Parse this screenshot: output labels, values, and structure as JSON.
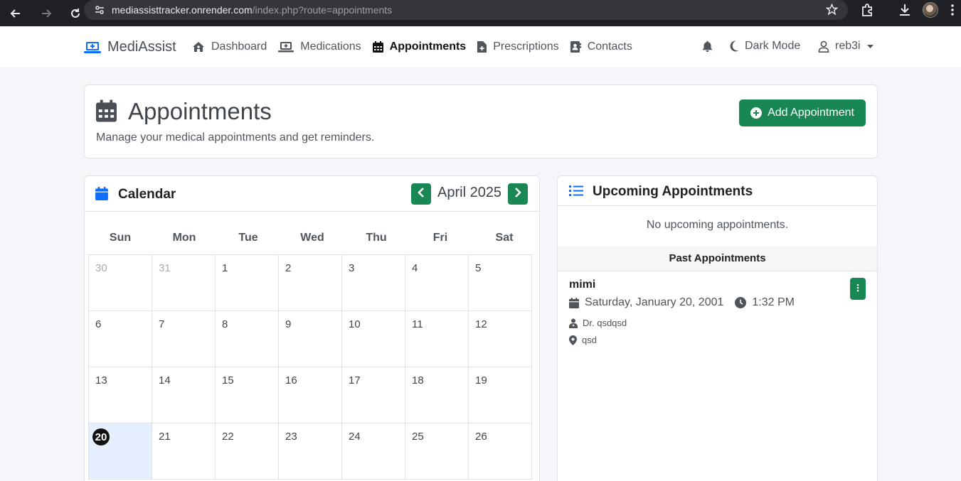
{
  "browser": {
    "url_domain": "mediassisttracker.onrender.com",
    "url_path": "/index.php?route=appointments"
  },
  "navbar": {
    "brand": "MediAssist",
    "links": [
      {
        "label": "Dashboard",
        "icon": "house-icon"
      },
      {
        "label": "Medications",
        "icon": "medical-kit-icon"
      },
      {
        "label": "Appointments",
        "icon": "calendar-icon",
        "active": true
      },
      {
        "label": "Prescriptions",
        "icon": "file-medical-icon"
      },
      {
        "label": "Contacts",
        "icon": "address-book-icon"
      }
    ],
    "dark_mode_label": "Dark Mode",
    "username": "reb3i"
  },
  "header": {
    "title": "Appointments",
    "subtitle": "Manage your medical appointments and get reminders.",
    "add_button": "Add Appointment"
  },
  "calendar": {
    "title": "Calendar",
    "month_label": "April 2025",
    "weekdays": [
      "Sun",
      "Mon",
      "Tue",
      "Wed",
      "Thu",
      "Fri",
      "Sat"
    ],
    "weeks": [
      [
        {
          "d": "30",
          "other": true
        },
        {
          "d": "31",
          "other": true
        },
        {
          "d": "1"
        },
        {
          "d": "2"
        },
        {
          "d": "3"
        },
        {
          "d": "4"
        },
        {
          "d": "5"
        }
      ],
      [
        {
          "d": "6"
        },
        {
          "d": "7"
        },
        {
          "d": "8"
        },
        {
          "d": "9"
        },
        {
          "d": "10"
        },
        {
          "d": "11"
        },
        {
          "d": "12"
        }
      ],
      [
        {
          "d": "13"
        },
        {
          "d": "14"
        },
        {
          "d": "15"
        },
        {
          "d": "16"
        },
        {
          "d": "17"
        },
        {
          "d": "18"
        },
        {
          "d": "19"
        }
      ],
      [
        {
          "d": "20",
          "today": true
        },
        {
          "d": "21"
        },
        {
          "d": "22"
        },
        {
          "d": "23"
        },
        {
          "d": "24"
        },
        {
          "d": "25"
        },
        {
          "d": "26"
        }
      ]
    ]
  },
  "upcoming": {
    "title": "Upcoming Appointments",
    "empty_text": "No upcoming appointments.",
    "past_header": "Past Appointments",
    "past": [
      {
        "name": "mimi",
        "date": "Saturday, January 20, 2001",
        "time": "1:32 PM",
        "doctor": "Dr. qsdqsd",
        "location": "qsd"
      }
    ]
  },
  "colors": {
    "accent_green": "#198754",
    "brand_blue": "#0d6efd",
    "today_bg": "#e5effd"
  }
}
